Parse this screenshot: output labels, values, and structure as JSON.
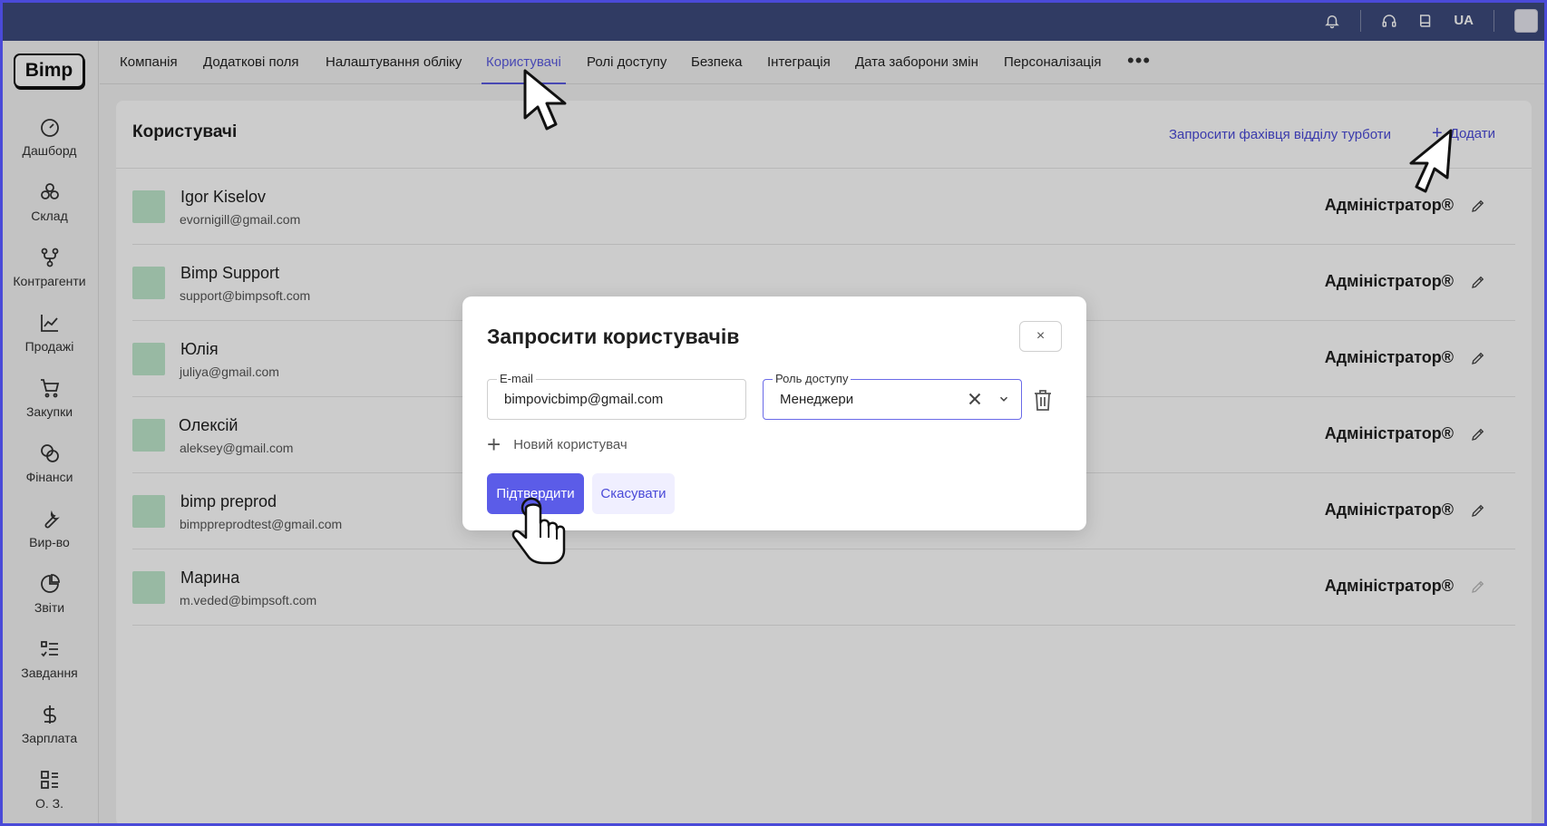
{
  "topbar": {
    "icons": [
      "bell-icon",
      "headset-icon",
      "book-icon"
    ],
    "language": "UA"
  },
  "sidebar": {
    "logo": "Bimp",
    "items": [
      {
        "label": "Дашборд",
        "icon": "gauge-icon"
      },
      {
        "label": "Склад",
        "icon": "boxes-icon"
      },
      {
        "label": "Контрагенти",
        "icon": "network-icon"
      },
      {
        "label": "Продажі",
        "icon": "chart-line-icon"
      },
      {
        "label": "Закупки",
        "icon": "cart-icon"
      },
      {
        "label": "Фінанси",
        "icon": "coins-icon"
      },
      {
        "label": "Вир-во",
        "icon": "wrench-icon"
      },
      {
        "label": "Звіти",
        "icon": "pie-chart-icon"
      },
      {
        "label": "Завдання",
        "icon": "checklist-icon"
      },
      {
        "label": "Зарплата",
        "icon": "dollar-icon"
      },
      {
        "label": "О. З.",
        "icon": "grid-list-icon"
      }
    ]
  },
  "tabs": [
    {
      "label": "Компанія"
    },
    {
      "label": "Додаткові поля"
    },
    {
      "label": "Налаштування обліку"
    },
    {
      "label": "Користувачі",
      "active": true
    },
    {
      "label": "Ролі доступу"
    },
    {
      "label": "Безпека"
    },
    {
      "label": "Інтеграція"
    },
    {
      "label": "Дата заборони змін"
    },
    {
      "label": "Персоналізація"
    }
  ],
  "tabs_more": "•••",
  "page": {
    "title": "Користувачі",
    "invite_link": "Запросити фахівця відділу турботи",
    "add_label": "Додати",
    "add_plus": "+"
  },
  "users": [
    {
      "name": "Igor Kiselov",
      "email": "evornigill@gmail.com",
      "role": "Адміністратор®"
    },
    {
      "name": "Bimp Support",
      "email": "support@bimpsoft.com",
      "role": "Адміністратор®"
    },
    {
      "name": "Юлія",
      "email": "juliya@gmail.com",
      "role": "Адміністратор®"
    },
    {
      "name": "Олексій",
      "email": "aleksey@gmail.com",
      "role": "Адміністратор®"
    },
    {
      "name": "bimp preprod",
      "email": "bimppreprodtest@gmail.com",
      "role": "Адміністратор®"
    },
    {
      "name": "Марина",
      "email": "m.veded@bimpsoft.com",
      "role": "Адміністратор®"
    }
  ],
  "modal": {
    "title": "Запросити користувачів",
    "close": "×",
    "email_label": "E-mail",
    "email_value": "bimpovicbimp@gmail.com",
    "role_label": "Роль доступу",
    "role_value": "Менеджери",
    "new_user_plus": "+",
    "new_user_label": "Новий користувач",
    "confirm": "Підтвердити",
    "cancel": "Скасувати"
  },
  "colors": {
    "accent": "#5b5ce8",
    "topbar": "#3d4a7c",
    "avatar": "#bfe8cc"
  }
}
